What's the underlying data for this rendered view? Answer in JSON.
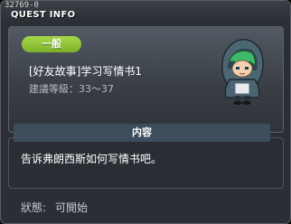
{
  "window": {
    "quest_id": "32769-0",
    "title": "QUEST INFO"
  },
  "quest": {
    "badge": "一般",
    "name": "[好友故事]学习写情书1",
    "level_requirement": "建議等級：33～37",
    "npc_icon": "hooded-green-hair-character"
  },
  "content": {
    "header": "内容",
    "text": "告诉弗朗西斯如何写情书吧。"
  },
  "status": {
    "label": "狀態:",
    "value": "可開始"
  },
  "colors": {
    "badge_green": "#8fc43a",
    "content_header": "#3c4e5c",
    "panel_bg": "#2b2f35"
  }
}
